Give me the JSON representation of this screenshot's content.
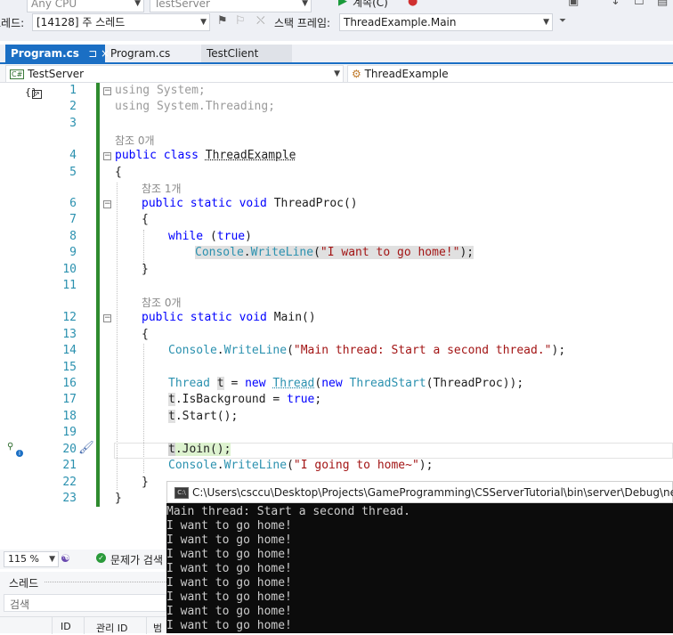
{
  "toolbar": {
    "cpu_combo": "Any CPU",
    "project_combo": "TestServer",
    "thread_label": "스레드:",
    "thread_value": "[14128] 주 스레드",
    "stack_label": "스택 프레임:",
    "stack_value": "ThreadExample.Main",
    "continue_label": "계속(C)"
  },
  "tabs": [
    {
      "label": "Program.cs",
      "pin": "⊐ ×"
    },
    {
      "label": "Program.cs"
    },
    {
      "label": "TestClient"
    }
  ],
  "nav": {
    "project": "TestServer",
    "class": "ThreadExample"
  },
  "codelens": {
    "refs0a": "참조 0개",
    "refs1": "참조 1개",
    "refs0b": "참조 0개"
  },
  "line_numbers": [
    "1",
    "2",
    "3",
    "4",
    "5",
    "6",
    "7",
    "8",
    "9",
    "10",
    "11",
    "12",
    "13",
    "14",
    "15",
    "16",
    "17",
    "18",
    "19",
    "20",
    "21",
    "22",
    "23"
  ],
  "status": {
    "zoom": "115 %",
    "problems": "문제가 검색"
  },
  "threads_panel": {
    "title": "스레드",
    "search_placeholder": "검색",
    "col_id": "ID",
    "col_managed_id": "관리 ID",
    "col_cat": "범"
  },
  "console": {
    "title": "C:\\Users\\csccu\\Desktop\\Projects\\GameProgramming\\CSServerTutorial\\bin\\server\\Debug\\net",
    "lines": [
      "Main thread: Start a second thread.",
      "I want to go home!",
      "I want to go home!",
      "I want to go home!",
      "I want to go home!",
      "I want to go home!",
      "I want to go home!",
      "I want to go home!",
      "I want to go home!"
    ]
  }
}
